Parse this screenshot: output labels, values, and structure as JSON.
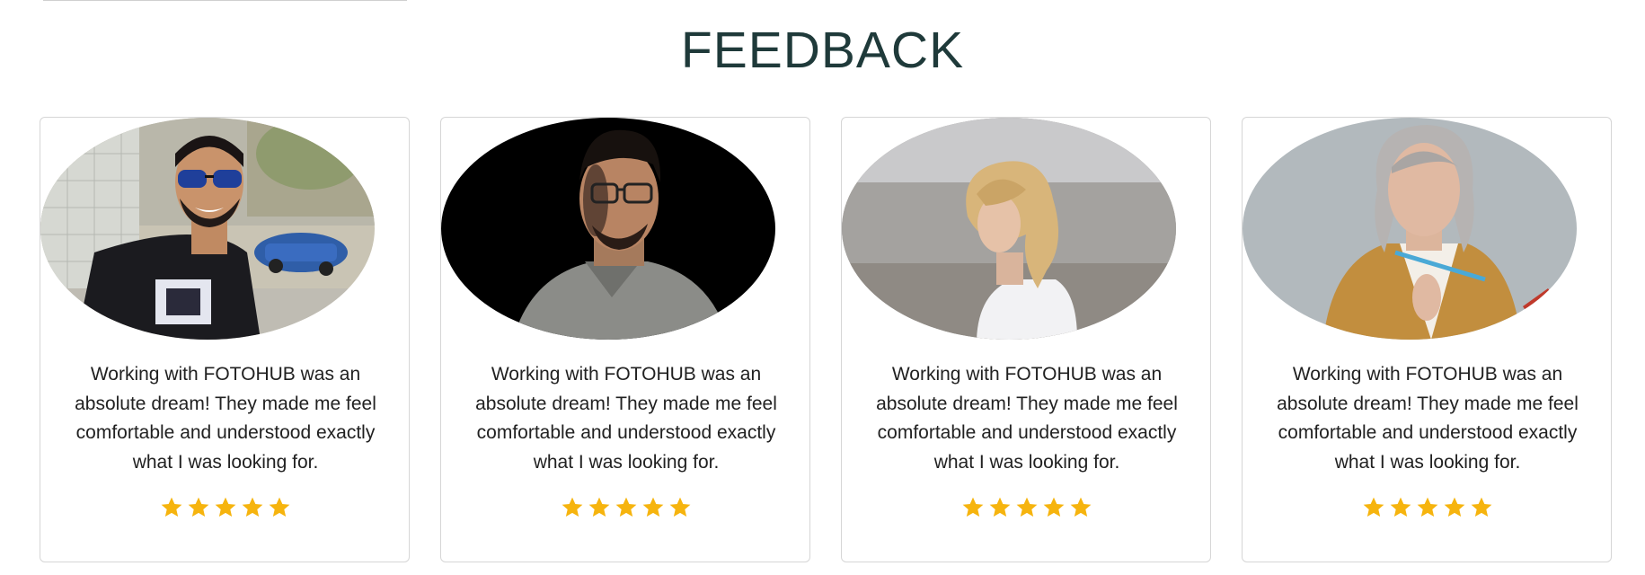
{
  "section": {
    "title": "FEEDBACK"
  },
  "colors": {
    "title": "#1f3a3a",
    "card_border": "#d6d6d6",
    "star": "#f6b40e",
    "text": "#212121"
  },
  "testimonials": [
    {
      "photo_icon": "smiling-man-sunglasses-photo",
      "quote": "Working with FOTOHUB was an absolute dream! They made me feel comfortable and understood exactly what I was looking for.",
      "rating": 5
    },
    {
      "photo_icon": "man-glasses-dark-background-photo",
      "quote": "Working with FOTOHUB was an absolute dream! They made me feel comfortable and understood exactly what I was looking for.",
      "rating": 5
    },
    {
      "photo_icon": "curly-haired-woman-seaside-photo",
      "quote": "Working with FOTOHUB was an absolute dream! They made me feel comfortable and understood exactly what I was looking for.",
      "rating": 5
    },
    {
      "photo_icon": "grey-haired-woman-blazer-photo",
      "quote": "Working with FOTOHUB was an absolute dream! They made me feel comfortable and understood exactly what I was looking for.",
      "rating": 5
    }
  ]
}
